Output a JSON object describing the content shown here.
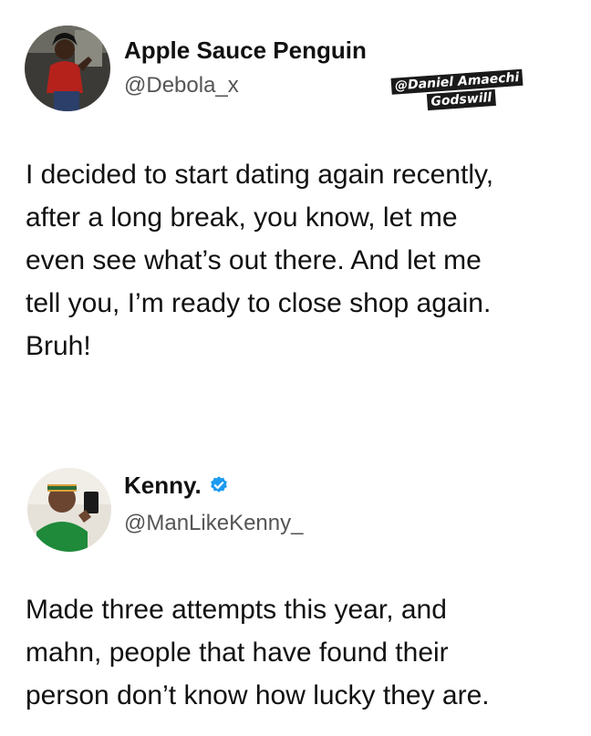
{
  "posts": [
    {
      "author_name": "Apple Sauce Penguin",
      "author_handle": "@Debola_x",
      "verified": false,
      "avatar_icon": "profile-photo",
      "body_lines": [
        "I decided to start dating again recently,",
        "after a long break, you know, let me",
        "even see what’s out there. And let me",
        "tell you, I’m ready to close shop again.",
        "Bruh!"
      ]
    },
    {
      "author_name": "Kenny.",
      "author_handle": "@ManLikeKenny_",
      "verified": true,
      "verified_color": "#1D9BF0",
      "avatar_icon": "profile-photo",
      "body_lines": [
        "Made three attempts this year, and",
        "mahn, people that have found their",
        "person don’t know how lucky they are."
      ]
    }
  ],
  "watermark": {
    "line1": "@Daniel Amaechi",
    "line2": "Godswill"
  }
}
